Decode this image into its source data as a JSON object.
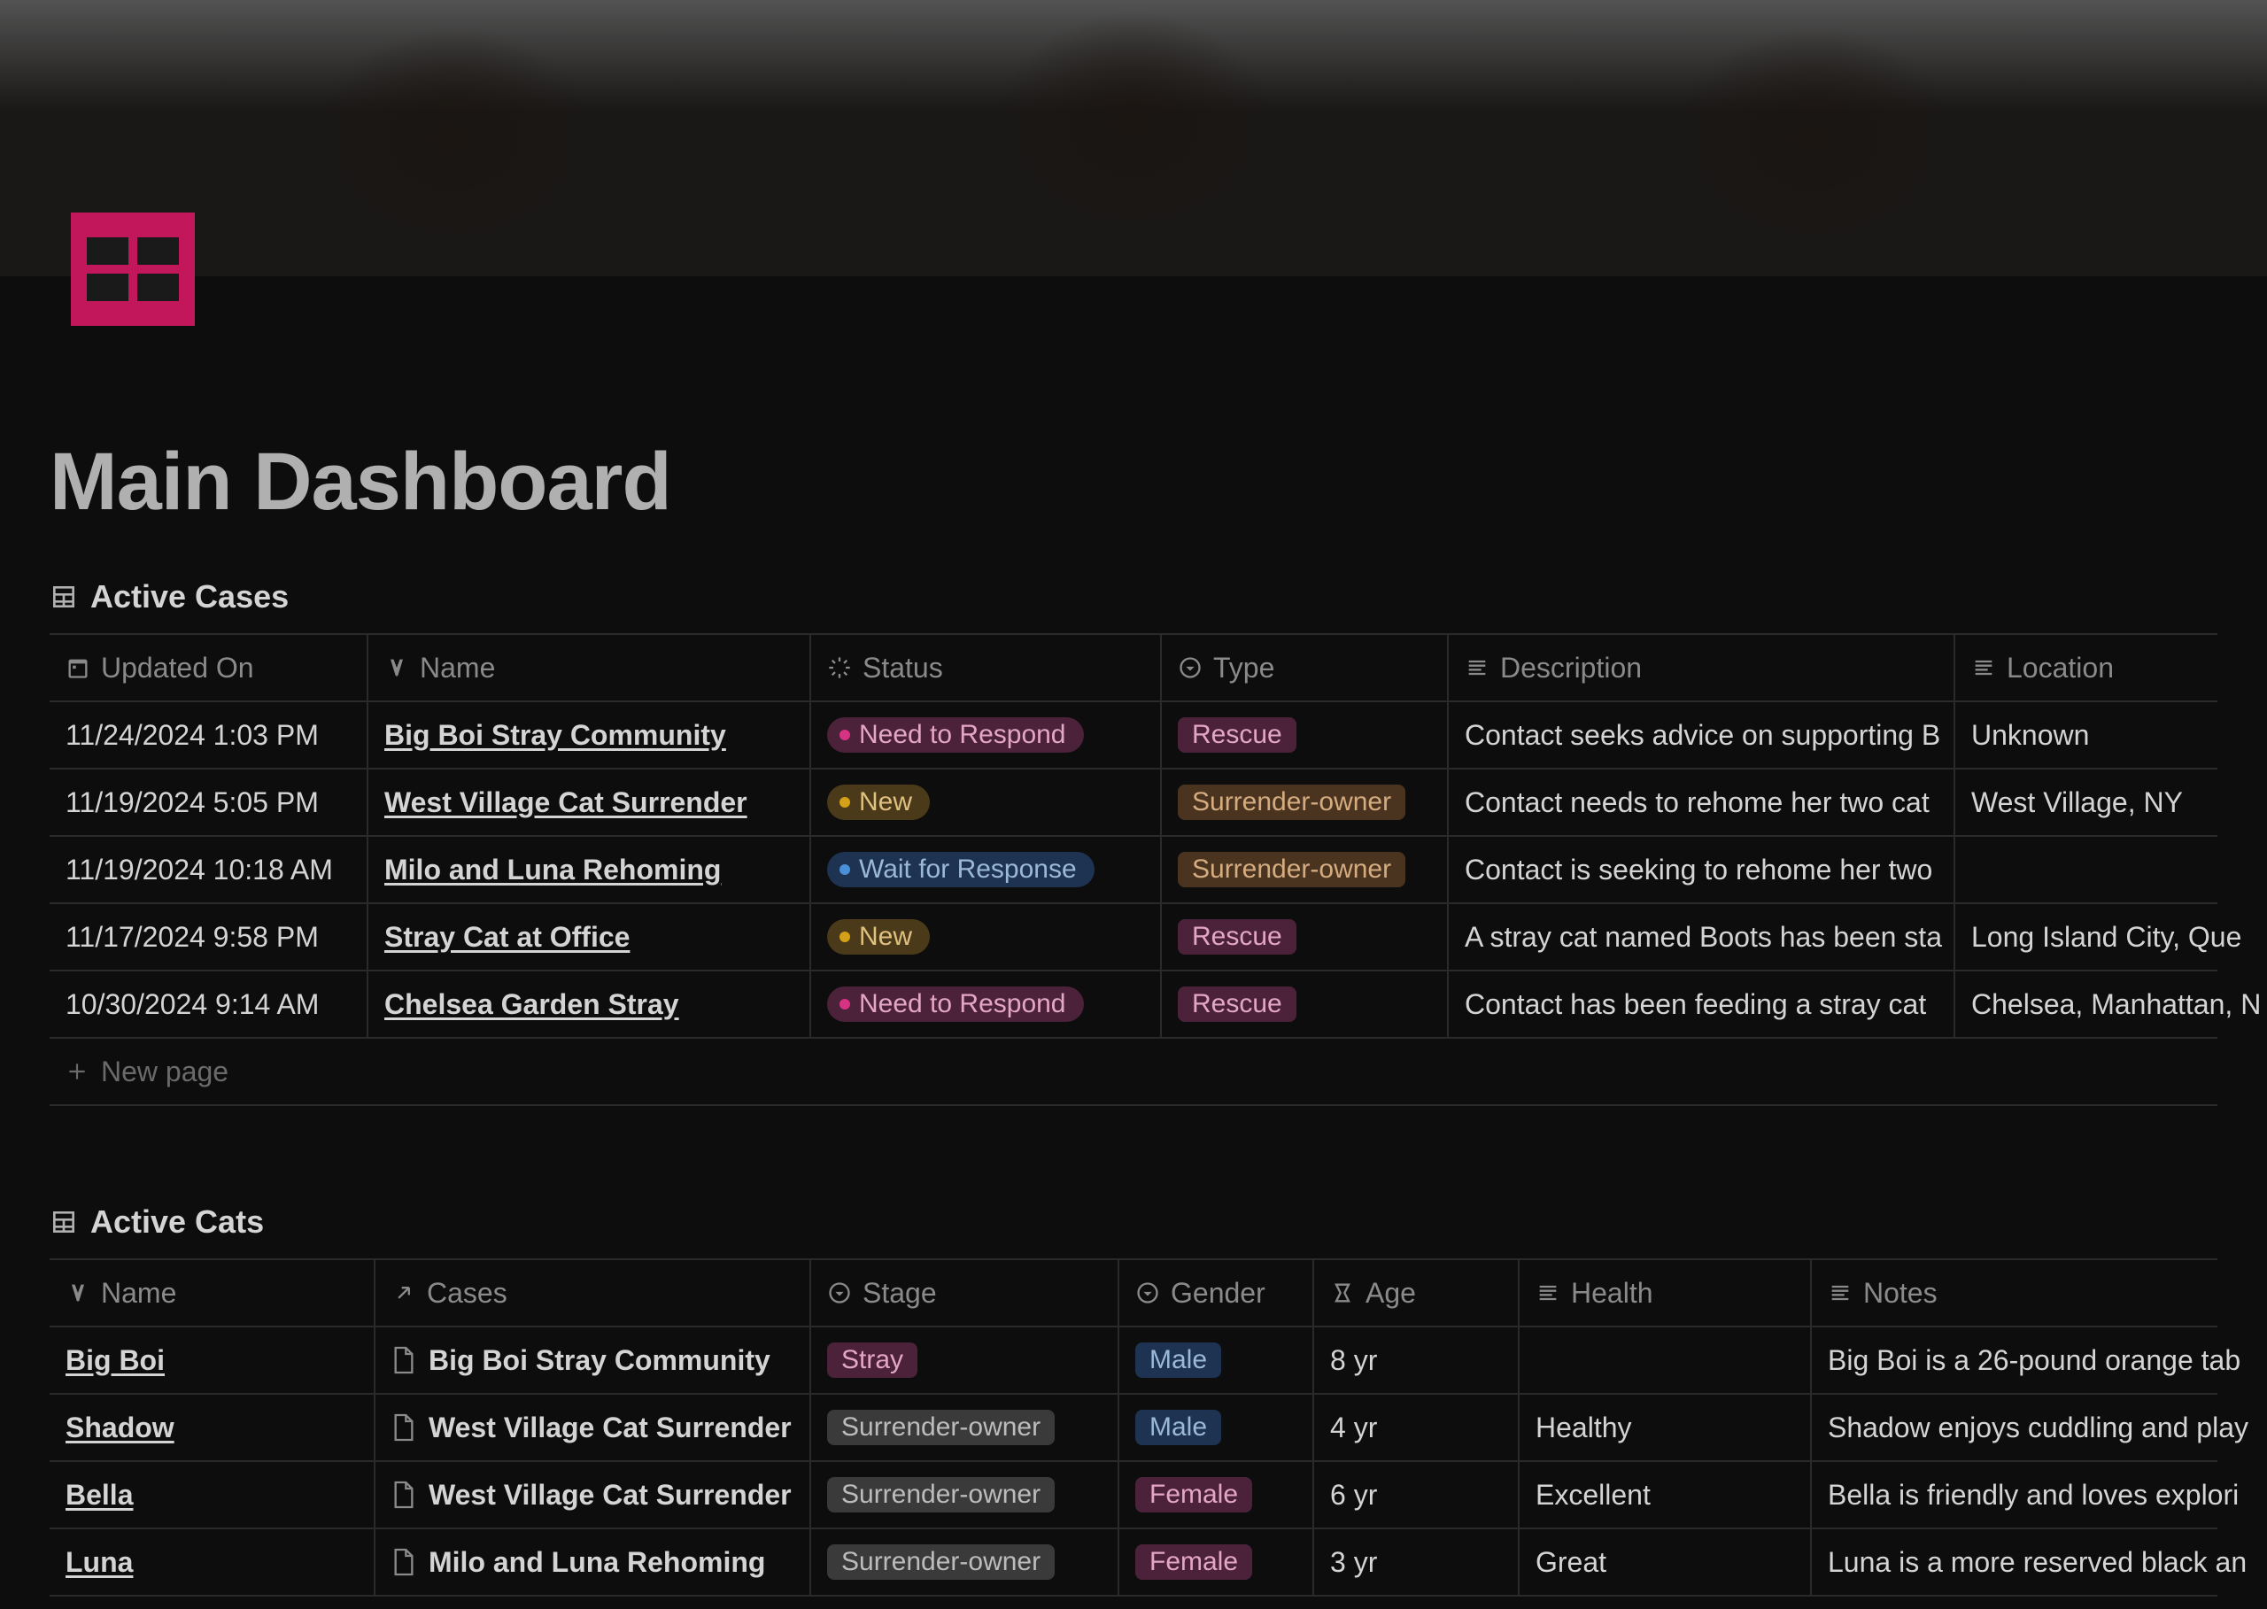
{
  "page": {
    "title": "Main Dashboard"
  },
  "view1": {
    "title": "Active Cases",
    "cols": [
      "Updated On",
      "Name",
      "Status",
      "Type",
      "Description",
      "Location"
    ],
    "rows": [
      {
        "updated": "11/24/2024 1:03 PM",
        "name": "Big Boi Stray Community",
        "status": "Need to Respond",
        "type": "Rescue",
        "desc": "Contact seeks advice on supporting B",
        "loc": "Unknown"
      },
      {
        "updated": "11/19/2024 5:05 PM",
        "name": "West Village Cat Surrender",
        "status": "New",
        "type": "Surrender-owner",
        "desc": "Contact needs to rehome her two cat",
        "loc": "West Village, NY"
      },
      {
        "updated": "11/19/2024 10:18 AM",
        "name": "Milo and Luna Rehoming",
        "status": "Wait for Response",
        "type": "Surrender-owner",
        "desc": "Contact is seeking to rehome her two",
        "loc": ""
      },
      {
        "updated": "11/17/2024 9:58 PM",
        "name": "Stray Cat at Office",
        "status": "New",
        "type": "Rescue",
        "desc": "A stray cat named Boots has been sta",
        "loc": "Long Island City, Que"
      },
      {
        "updated": "10/30/2024 9:14 AM",
        "name": "Chelsea Garden Stray",
        "status": "Need to Respond",
        "type": "Rescue",
        "desc": "Contact has been feeding a stray cat",
        "loc": "Chelsea, Manhattan, N"
      }
    ],
    "newPage": "New page"
  },
  "view2": {
    "title": "Active Cats",
    "cols": [
      "Name",
      "Cases",
      "Stage",
      "Gender",
      "Age",
      "Health",
      "Notes"
    ],
    "rows": [
      {
        "name": "Big Boi",
        "case": "Big Boi Stray Community",
        "stage": "Stray",
        "gender": "Male",
        "age": "8 yr",
        "health": "",
        "notes": "Big Boi is a 26-pound orange tab"
      },
      {
        "name": "Shadow",
        "case": "West Village Cat Surrender",
        "stage": "Surrender-owner",
        "gender": "Male",
        "age": "4 yr",
        "health": "Healthy",
        "notes": "Shadow enjoys cuddling and play"
      },
      {
        "name": "Bella",
        "case": "West Village Cat Surrender",
        "stage": "Surrender-owner",
        "gender": "Female",
        "age": "6 yr",
        "health": "Excellent",
        "notes": "Bella is friendly and loves explori"
      },
      {
        "name": "Luna",
        "case": "Milo and Luna Rehoming",
        "stage": "Surrender-owner",
        "gender": "Female",
        "age": "3 yr",
        "health": "Great",
        "notes": "Luna is a more reserved black an"
      }
    ]
  },
  "statusClass": {
    "Need to Respond": "pill-need",
    "New": "pill-new",
    "Wait for Response": "pill-wait"
  },
  "typeClass": {
    "Rescue": "tag-rescue",
    "Surrender-owner": "tag-surrender"
  },
  "stageClass": {
    "Stray": "tag-stray",
    "Surrender-owner": "tag-surrgrey"
  },
  "genderClass": {
    "Male": "tag-male",
    "Female": "tag-female"
  }
}
